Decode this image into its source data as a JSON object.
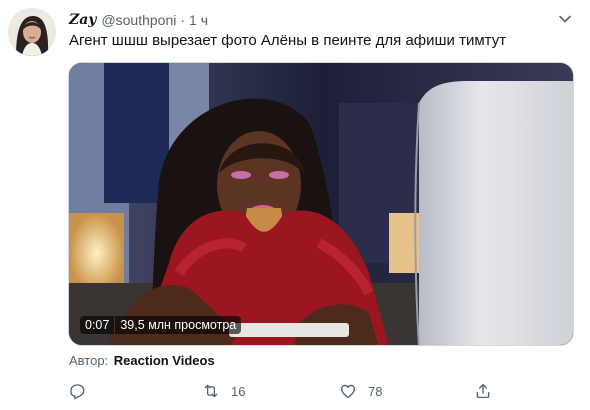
{
  "tweet": {
    "display_name": "Zay",
    "handle": "@southponi",
    "separator": "·",
    "time": "1 ч",
    "text": "Агент шшш вырезает фото Алёны в пеинте для афиши тимтут",
    "avatar": "profile-photo",
    "menu_icon": "chevron-down-icon"
  },
  "media": {
    "type": "video",
    "thumbnail": "woman-at-computer-reaction",
    "duration": "0:07",
    "views": "39,5 млн просмотра",
    "attribution_label": "Автор:",
    "attribution_author": "Reaction Videos"
  },
  "actions": {
    "reply": {
      "icon": "reply-icon",
      "count": ""
    },
    "retweet": {
      "icon": "retweet-icon",
      "count": "16"
    },
    "like": {
      "icon": "heart-icon",
      "count": "78"
    },
    "share": {
      "icon": "share-icon",
      "count": ""
    }
  },
  "colors": {
    "text_primary": "#0f1419",
    "text_secondary": "#536471",
    "border": "#cfd9de"
  }
}
